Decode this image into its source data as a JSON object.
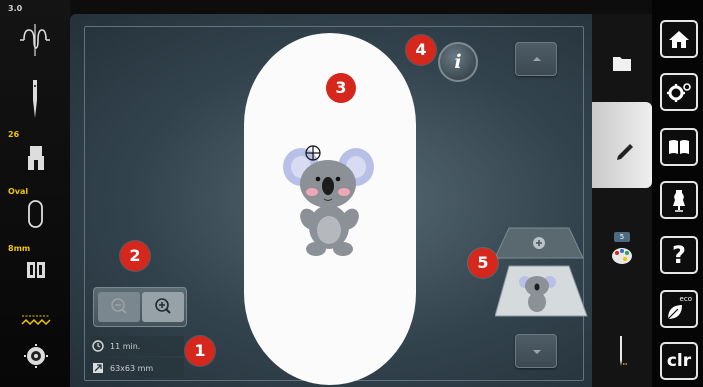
{
  "left_bar": {
    "tension_value": "3.0",
    "presser_foot_value": "26",
    "hoop_label": "Oval",
    "needle_size_label": "8mm"
  },
  "main": {
    "info_button_label": "i",
    "stitch_time": "11 min.",
    "design_size": "63x63 mm"
  },
  "callouts": [
    "1",
    "2",
    "3",
    "4",
    "5"
  ],
  "tabs": {
    "color_count": "5"
  },
  "right_bar": {
    "clr_label": "clr",
    "eco_label": "eco",
    "help_label": "?"
  },
  "colors": {
    "accent_red": "#d5271c",
    "status_yellow": "#f2c400",
    "panel_bg": "#33434d"
  },
  "icons": [
    "tension-icon",
    "needle-icon",
    "presser-foot-icon",
    "hoop-icon",
    "feed-dog-icon",
    "thread-cut-icon",
    "bobbin-icon",
    "zoom-out-icon",
    "zoom-in-icon",
    "clock-icon",
    "resize-icon",
    "folder-icon",
    "pencil-icon",
    "palette-icon",
    "needle-position-icon",
    "home-icon",
    "settings-icon",
    "book-icon",
    "dress-form-icon",
    "help-icon",
    "eco-icon"
  ]
}
